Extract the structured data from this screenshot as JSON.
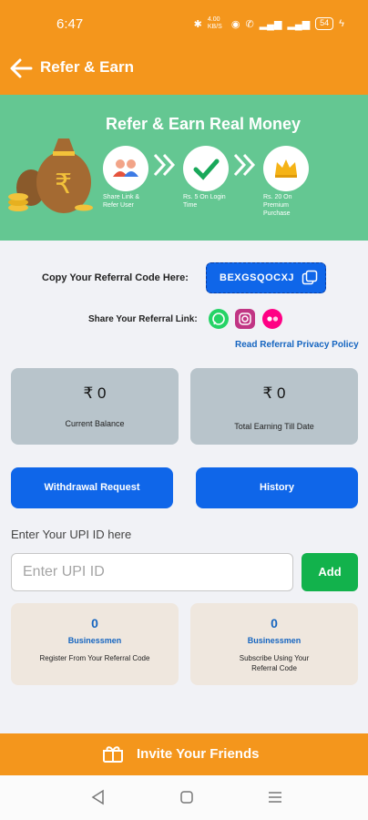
{
  "status": {
    "time": "6:47",
    "net": "4.00 KB/S",
    "battery": "54"
  },
  "header": {
    "title": "Refer & Earn"
  },
  "banner": {
    "title": "Refer & Earn Real Money",
    "steps": [
      {
        "caption": "Share Link & Refer User",
        "icon": "users-icon"
      },
      {
        "caption": "Rs. 5 On Login Time",
        "icon": "checkmark-icon"
      },
      {
        "caption": "Rs. 20 On Premium Purchase",
        "icon": "crown-icon"
      }
    ]
  },
  "referral": {
    "code_label": "Copy Your Referral Code Here:",
    "code": "BEXGSQOCXJ",
    "share_label": "Share Your Referral Link:",
    "policy_link": "Read Referral Privacy Policy"
  },
  "stats": [
    {
      "amount": "₹ 0",
      "label": "Current Balance"
    },
    {
      "amount": "₹ 0",
      "label": "Total Earning Till Date"
    }
  ],
  "buttons": {
    "withdrawal": "Withdrawal Request",
    "history": "History"
  },
  "upi": {
    "label": "Enter Your UPI ID here",
    "placeholder": "Enter UPI ID",
    "value": "",
    "add": "Add"
  },
  "business": [
    {
      "count": "0",
      "label": "Businessmen",
      "desc": "Register From Your Referral Code"
    },
    {
      "count": "0",
      "label": "Businessmen",
      "desc": "Subscribe Using Your Referral Code"
    }
  ],
  "invite": {
    "label": "Invite Your Friends"
  },
  "colors": {
    "brand": "#f4961c",
    "banner": "#64c792",
    "primary": "#0f66e9",
    "success": "#12b24c",
    "link": "#1565c0"
  }
}
